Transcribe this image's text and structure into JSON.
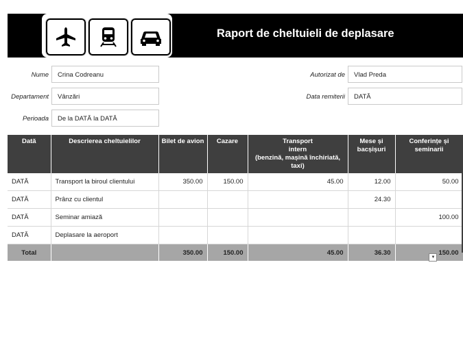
{
  "header": {
    "title": "Raport de cheltuieli de deplasare",
    "icons": [
      "airplane-icon",
      "train-icon",
      "car-icon"
    ]
  },
  "form": {
    "name_label": "Nume",
    "name_value": "Crina Codreanu",
    "department_label": "Departament",
    "department_value": "Vânzări",
    "period_label": "Perioada",
    "period_value": "De la  DATĂ  la DATĂ",
    "authorized_label": "Autorizat de",
    "authorized_value": "Vlad Preda",
    "submit_date_label": "Data remiterii",
    "submit_date_value": "DATĂ"
  },
  "table": {
    "columns": {
      "date": "Dată",
      "desc": "Descrierea cheltuielilor",
      "airfare": "Bilet de avion",
      "lodging": "Cazare",
      "transport_l1": "Transport",
      "transport_l2": "intern",
      "transport_l3": "(benzină, mașină închiriată, taxi)",
      "meals_l1": "Mese și",
      "meals_l2": "bacșișuri",
      "conf_l1": "Conferințe și",
      "conf_l2": "seminarii"
    },
    "rows": [
      {
        "date": "DATĂ",
        "desc": "Transport la biroul clientului",
        "airfare": "350.00",
        "lodging": "150.00",
        "transport": "45.00",
        "meals": "12.00",
        "conf": "50.00"
      },
      {
        "date": "DATĂ",
        "desc": "Prânz cu clientul",
        "airfare": "",
        "lodging": "",
        "transport": "",
        "meals": "24.30",
        "conf": ""
      },
      {
        "date": "DATĂ",
        "desc": "Seminar amiază",
        "airfare": "",
        "lodging": "",
        "transport": "",
        "meals": "",
        "conf": "100.00"
      },
      {
        "date": "DATĂ",
        "desc": "Deplasare la aeroport",
        "airfare": "",
        "lodging": "",
        "transport": "",
        "meals": "",
        "conf": ""
      }
    ],
    "total": {
      "label": "Total",
      "airfare": "350.00",
      "lodging": "150.00",
      "transport": "45.00",
      "meals": "36.30",
      "conf": "150.00"
    }
  },
  "colors": {
    "banner": "#000000",
    "header": "#3f3f3f",
    "total": "#a6a6a6"
  }
}
